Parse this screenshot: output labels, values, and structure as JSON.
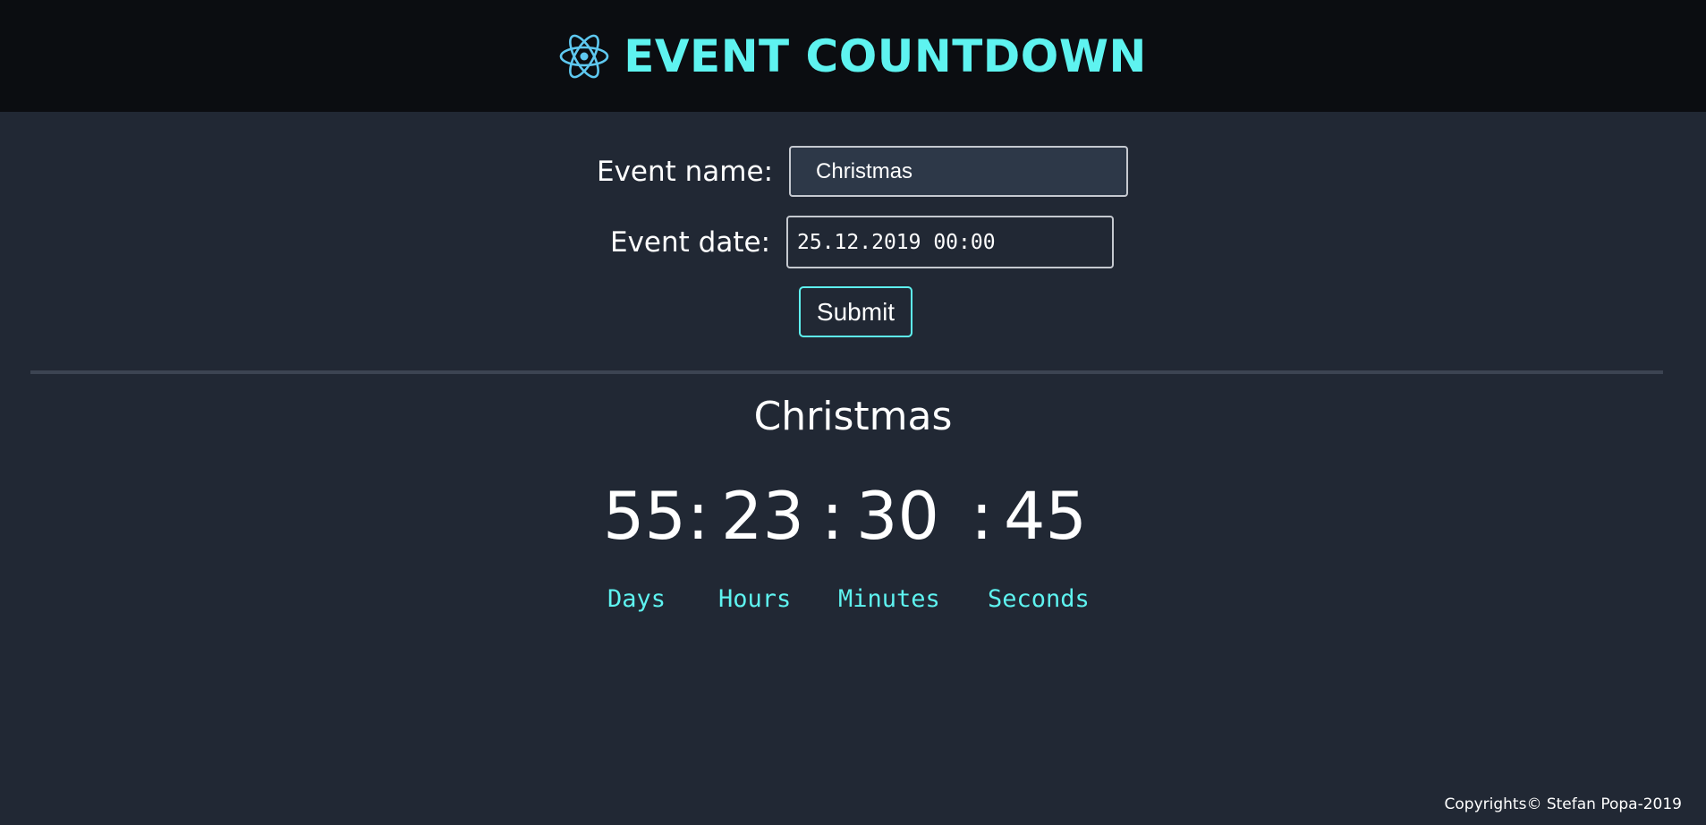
{
  "header": {
    "title": "EVENT COUNTDOWN",
    "logo_icon": "react-atom-icon",
    "accent_color": "#5ef3f0"
  },
  "form": {
    "name_label": "Event name:",
    "name_value": "Christmas",
    "date_label": "Event date:",
    "date_value": "25.12.2019 00:00",
    "submit_label": "Submit"
  },
  "countdown": {
    "event_name": "Christmas",
    "days": "55",
    "hours": "23",
    "minutes": "30",
    "seconds": "45",
    "separator": ":",
    "days_label": "Days",
    "hours_label": "Hours",
    "minutes_label": "Minutes",
    "seconds_label": "Seconds"
  },
  "footer": {
    "copyright": "Copyrights© Stefan Popa-2019"
  }
}
